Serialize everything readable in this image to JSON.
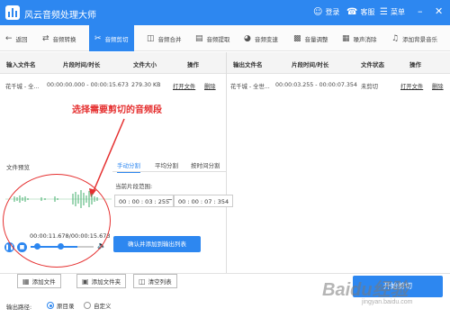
{
  "app": {
    "title": "风云音频处理大师",
    "login": "登录",
    "service": "客服",
    "menu": "菜单",
    "accent": "#2d87f0",
    "annotation_color": "#e53030"
  },
  "toolbar": {
    "back": "返回",
    "items": [
      "音频转换",
      "音频剪切",
      "音频合并",
      "音频提取",
      "音频变速",
      "音量调整",
      "噪声消除",
      "添加背景音乐"
    ]
  },
  "left_table": {
    "headers": [
      "输入文件名",
      "片段时间/时长",
      "文件大小",
      "操作"
    ],
    "rows": [
      {
        "name": "花千城 - 全...",
        "time": "00:00:00.000 - 00:00:15.673",
        "size": "279.30 KB",
        "open": "打开文件",
        "delete": "删除"
      }
    ]
  },
  "right_table": {
    "headers": [
      "输出文件名",
      "片段时间/时长",
      "文件状态",
      "操作"
    ],
    "rows": [
      {
        "name": "花千城 - 全世...",
        "time": "00:00:03.255 - 00:00:07.354",
        "status": "未剪切",
        "open": "打开文件",
        "delete": "删除"
      }
    ]
  },
  "annotation": "选择需要剪切的音频段",
  "preview": {
    "label": "文件预览",
    "time": "00:00:11.678/00:00:15.673",
    "progress": 0.745
  },
  "split": {
    "tabs": [
      "手动分割",
      "平均分割",
      "按时间分割"
    ],
    "segment_label": "当前片段范围:",
    "start": "00 : 00 : 03 : 255",
    "tilde": "~",
    "end": "00 : 00 : 07 : 354",
    "add_button": "确认并添加到输出列表"
  },
  "bottom": {
    "add_file": "添加文件",
    "add_folder": "添加文件夹",
    "clear_list": "清空列表",
    "output_path_label": "输出路径:",
    "radio_original": "原目录",
    "radio_custom": "自定义",
    "start_button": "开始剪切"
  },
  "watermark": {
    "text": "Baidu经验",
    "sub": "jingyan.baidu.com"
  }
}
